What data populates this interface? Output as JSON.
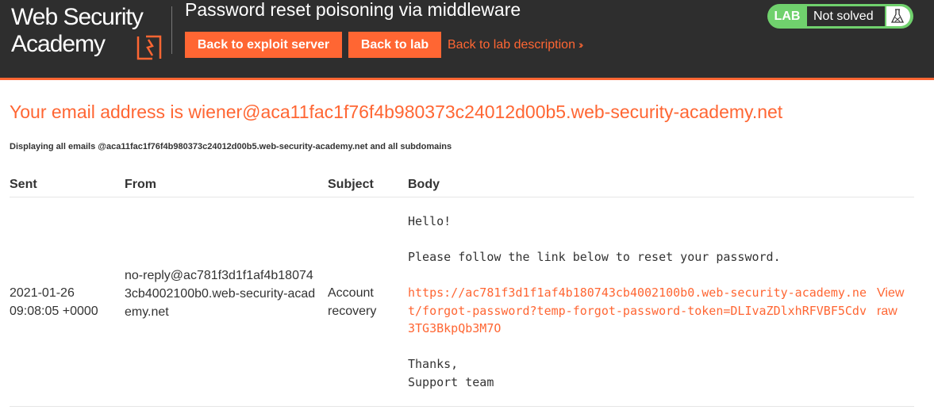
{
  "header": {
    "logo_line1": "Web Security",
    "logo_line2": "Academy",
    "lab_title": "Password reset poisoning via middleware",
    "buttons": {
      "exploit": "Back to exploit server",
      "lab": "Back to lab"
    },
    "description_link": "Back to lab description",
    "lab_status": {
      "badge": "LAB",
      "status": "Not solved",
      "icon": "flask-icon"
    },
    "colors": {
      "accent": "#ff6633",
      "header_bg": "#2e2e2e",
      "status_green": "#70d16d"
    }
  },
  "main": {
    "email_heading": "Your email address is wiener@aca11fac1f76f4b980373c24012d00b5.web-security-academy.net",
    "display_note": "Displaying all emails @aca11fac1f76f4b980373c24012d00b5.web-security-academy.net and all subdomains",
    "table": {
      "headers": [
        "Sent",
        "From",
        "Subject",
        "Body"
      ],
      "rows": [
        {
          "sent": "2021-01-26 09:08:05 +0000",
          "from": "no-reply@ac781f3d1f1af4b180743cb4002100b0.web-security-academy.net",
          "subject": "Account recovery",
          "body": {
            "greeting": "Hello!",
            "instruction": "Please follow the link below to reset your password.",
            "link": "https://ac781f3d1f1af4b180743cb4002100b0.web-security-academy.net/forgot-password?temp-forgot-password-token=DLIvaZDlxhRFVBF5Cdv3TG3BkpQb3M7O",
            "signoff": "Thanks,",
            "signature": "Support team"
          },
          "raw_link": "View raw"
        }
      ]
    }
  }
}
